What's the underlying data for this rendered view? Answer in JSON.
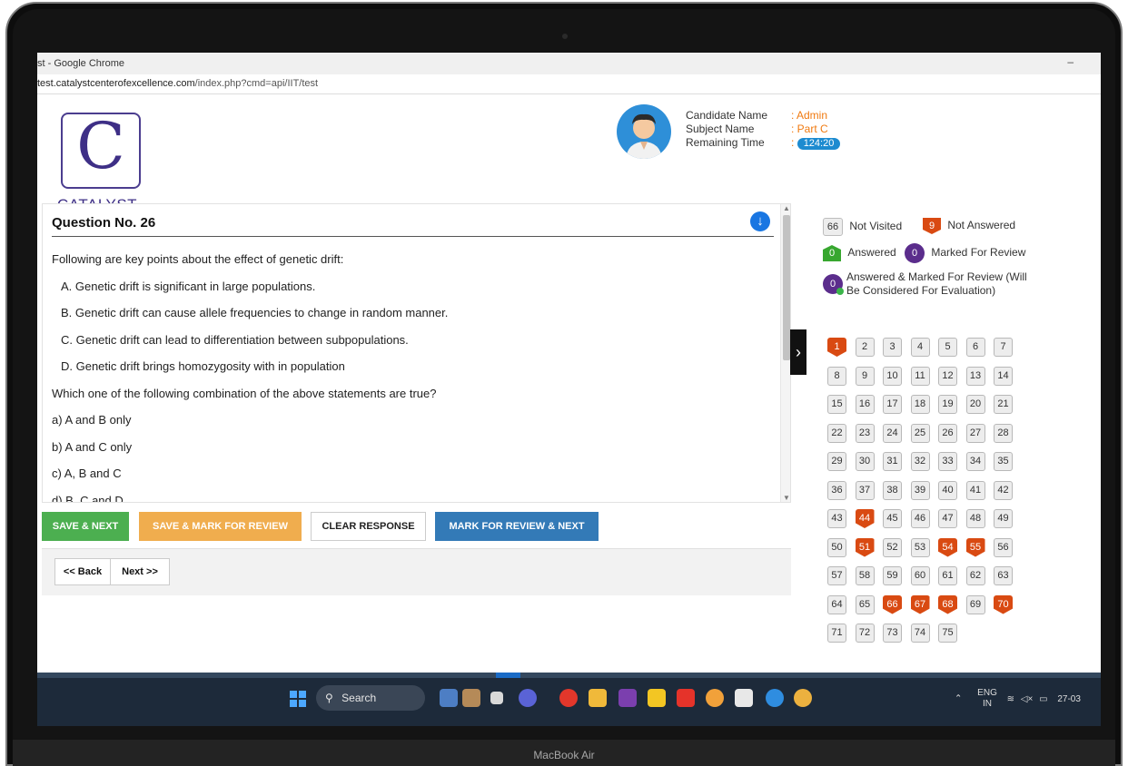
{
  "device": {
    "model_label": "MacBook Air"
  },
  "browser": {
    "window_title": "st - Google Chrome",
    "url_host": "test.catalystcenterofexcellence.com",
    "url_path": "/index.php?cmd=api/IIT/test",
    "minimize_glyph": "–"
  },
  "brand": {
    "logo_letter": "C",
    "logo_text": "CATALYST"
  },
  "candidate": {
    "name_label": "Candidate Name",
    "name_value": ": Admin",
    "subject_label": "Subject Name",
    "subject_value": ": Part C",
    "time_label": "Remaining Time",
    "time_prefix": ":",
    "time_value": "124:20"
  },
  "question": {
    "title": "Question No. 26",
    "lines": [
      "Following are key points about the effect of genetic drift:",
      "A.  Genetic drift is significant in large populations.",
      "B.  Genetic drift can cause allele frequencies to change in random manner.",
      "C.  Genetic drift can lead to differentiation between subpopulations.",
      "D. Genetic drift brings homozygosity with in population",
      "Which one of the following combination of the above statements are true?",
      "a) A and B only",
      "b) A and C only",
      "c) A, B and C",
      "d) B, C and D"
    ]
  },
  "actions": {
    "save_next": "SAVE & NEXT",
    "save_mark": "SAVE & MARK FOR REVIEW",
    "clear": "CLEAR RESPONSE",
    "mark_next": "MARK FOR REVIEW & NEXT",
    "back": "<< Back",
    "next": "Next >>"
  },
  "legend": {
    "not_visited_count": "66",
    "not_visited_label": "Not Visited",
    "not_answered_count": "9",
    "not_answered_label": "Not Answered",
    "answered_count": "0",
    "answered_label": "Answered",
    "marked_count": "0",
    "marked_label": "Marked For Review",
    "ans_marked_count": "0",
    "ans_marked_label": "Answered & Marked For Review (Will Be Considered For Evaluation)"
  },
  "palette": {
    "total": 75,
    "not_answered": [
      1,
      44,
      51,
      54,
      55,
      66,
      67,
      68,
      70
    ]
  },
  "taskbar": {
    "search_label": "Search",
    "tray_lang": "ENG",
    "tray_region": "IN",
    "tray_date": "27-03"
  },
  "colors": {
    "accent_blue": "#337ab7",
    "not_answered": "#d94a12",
    "answered": "#37a72f",
    "marked": "#5b2d8c",
    "orange_value": "#f07a10"
  }
}
